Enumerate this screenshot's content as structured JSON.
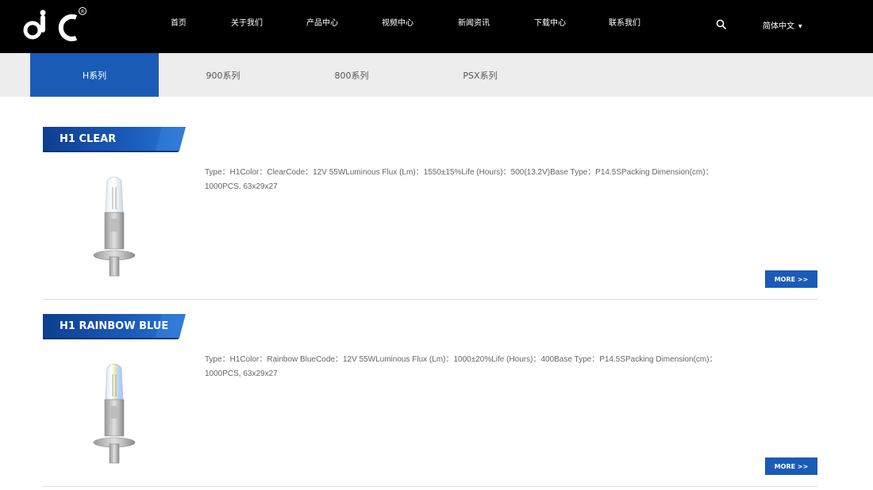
{
  "header": {
    "logo_alt": "OC",
    "nav": [
      {
        "label": "首页"
      },
      {
        "label": "关于我们"
      },
      {
        "label": "产品中心"
      },
      {
        "label": "视频中心"
      },
      {
        "label": "新闻资讯"
      },
      {
        "label": "下载中心"
      },
      {
        "label": "联系我们"
      }
    ],
    "language": "简体中文"
  },
  "tabs": [
    {
      "label": "H系列",
      "active": true
    },
    {
      "label": "900系列",
      "active": false
    },
    {
      "label": "800系列",
      "active": false
    },
    {
      "label": "PSX系列",
      "active": false
    }
  ],
  "products": [
    {
      "title": "H1 CLEAR",
      "description": "Type：H1Color：ClearCode：12V 55WLuminous Flux (Lm)：1550±15%Life (Hours)：500(13.2V)Base Type：P14.5SPacking Dimension(cm)：1000PCS, 63x29x27",
      "more_label": "MORE >>",
      "glass_tint": "clear"
    },
    {
      "title": "H1 RAINBOW BLUE",
      "description": "Type：H1Color：Rainbow BlueCode：12V 55WLuminous Flux (Lm)：1000±20%Life (Hours)：400Base Type：P14.5SPacking Dimension(cm)：1000PCS, 63x29x27",
      "more_label": "MORE >>",
      "glass_tint": "rainbow"
    }
  ],
  "colors": {
    "accent": "#1a5bb8",
    "header_bg": "#000000",
    "tabs_bg": "#ededed"
  }
}
